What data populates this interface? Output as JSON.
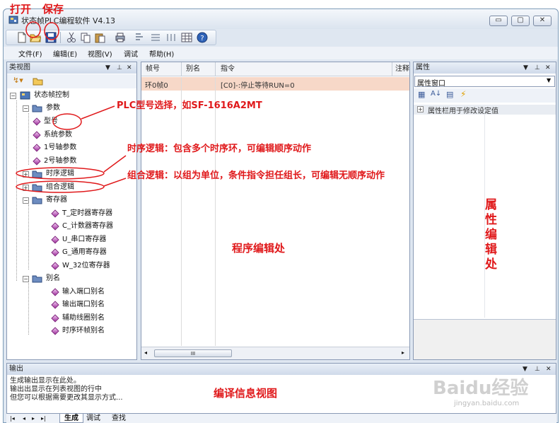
{
  "annotations": {
    "open": "打开",
    "save": "保存",
    "model_select": "PLC型号选择，如SF-1616A2MT",
    "timing_logic": "时序逻辑：包含多个时序环，可编辑顺序动作",
    "combo_logic": "组合逻辑：以组为单位，条件指令担任组长，可编辑无顺序动作",
    "program_area": "程序编辑处",
    "property_area": "属性编辑处",
    "output_area": "编译信息视图"
  },
  "window": {
    "title": "状态帧PLC编程软件 V4.13",
    "controls": {
      "minimize": "▭",
      "restore": "▢",
      "close": "✕"
    }
  },
  "menubar": {
    "items": [
      "文件(F)",
      "编辑(E)",
      "视图(V)",
      "调试",
      "帮助(H)"
    ]
  },
  "class_view": {
    "title": "类视图",
    "tree": {
      "root": "状态帧控制",
      "params": "参数",
      "model": "型号",
      "system_params": "系统参数",
      "axis1": "1号轴参数",
      "axis2": "2号轴参数",
      "timing_logic": "时序逻辑",
      "combo_logic": "组合逻辑",
      "registers": "寄存器",
      "reg_t": "T_定时器寄存器",
      "reg_c": "C_计数器寄存器",
      "reg_u": "U_串口寄存器",
      "reg_g": "G_通用寄存器",
      "reg_w": "W_32位寄存器",
      "alias": "别名",
      "alias_input": "输入端口别名",
      "alias_output": "输出端口别名",
      "alias_coil": "辅助线圈别名",
      "alias_timing": "时序环帧别名"
    }
  },
  "editor": {
    "columns": [
      "帧号",
      "别名",
      "指令",
      "注释"
    ],
    "row": {
      "frame": "环0帧0",
      "alias": "",
      "instruction": "[C0]-:停止等待RUN=0"
    },
    "scroll_thumb": "III"
  },
  "properties": {
    "title": "属性",
    "dropdown": "属性窗口",
    "category": "属性栏用于修改设定值"
  },
  "output": {
    "title": "输出",
    "lines": [
      "生成输出显示在此处。",
      "输出出显示在列表视图的行中",
      "但您可以根据需要更改其显示方式..."
    ],
    "tabs": [
      "生成",
      "调试",
      "查找"
    ]
  },
  "watermark": {
    "brand": "Baidu经验",
    "url": "jingyan.baidu.com"
  },
  "colors": {
    "annotation": "#e0191b",
    "row_highlight": "#f7d8c8",
    "header": "#cfdaea"
  }
}
